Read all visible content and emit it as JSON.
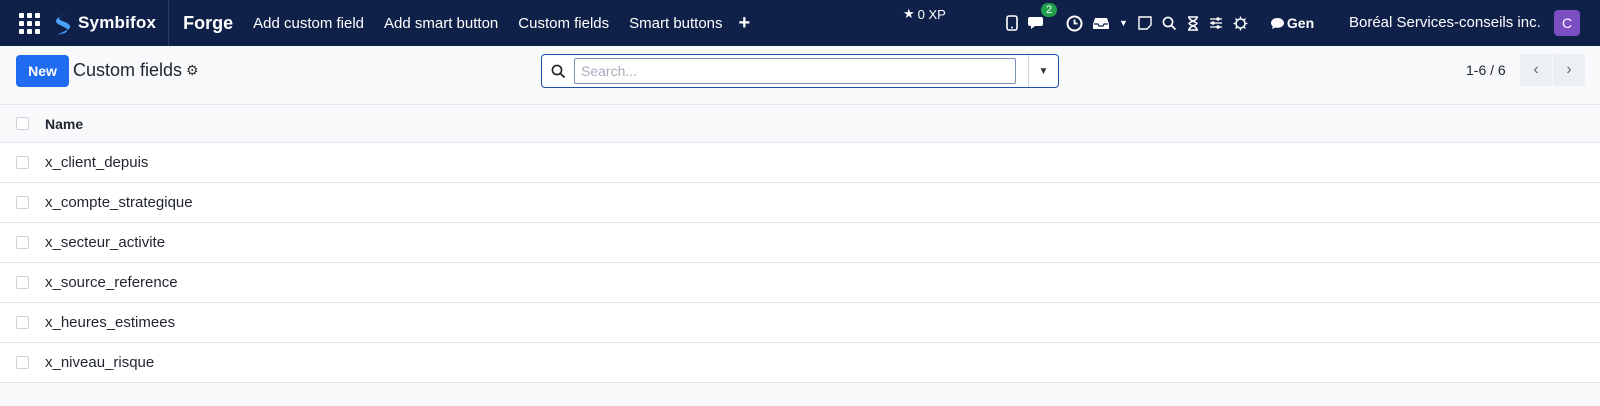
{
  "topbar": {
    "logo_text": "Symbifox",
    "app_name": "Forge",
    "menu": [
      "Add custom field",
      "Add smart button",
      "Custom fields",
      "Smart buttons"
    ],
    "xp": "0 XP",
    "messages_badge": "2",
    "gen_label": "Gen",
    "company": "Boréal Services-conseils inc.",
    "avatar_letter": "C"
  },
  "control": {
    "new_label": "New",
    "title": "Custom fields",
    "search_placeholder": "Search...",
    "pager": "1-6 / 6"
  },
  "table": {
    "header": "Name",
    "rows": [
      "x_client_depuis",
      "x_compte_strategique",
      "x_secteur_activite",
      "x_source_reference",
      "x_heures_estimees",
      "x_niveau_risque"
    ]
  },
  "colors": {
    "topbar": "#0f2049",
    "primary": "#1f6cf0",
    "avatar": "#7b4ec2",
    "badge": "#22a04b"
  }
}
